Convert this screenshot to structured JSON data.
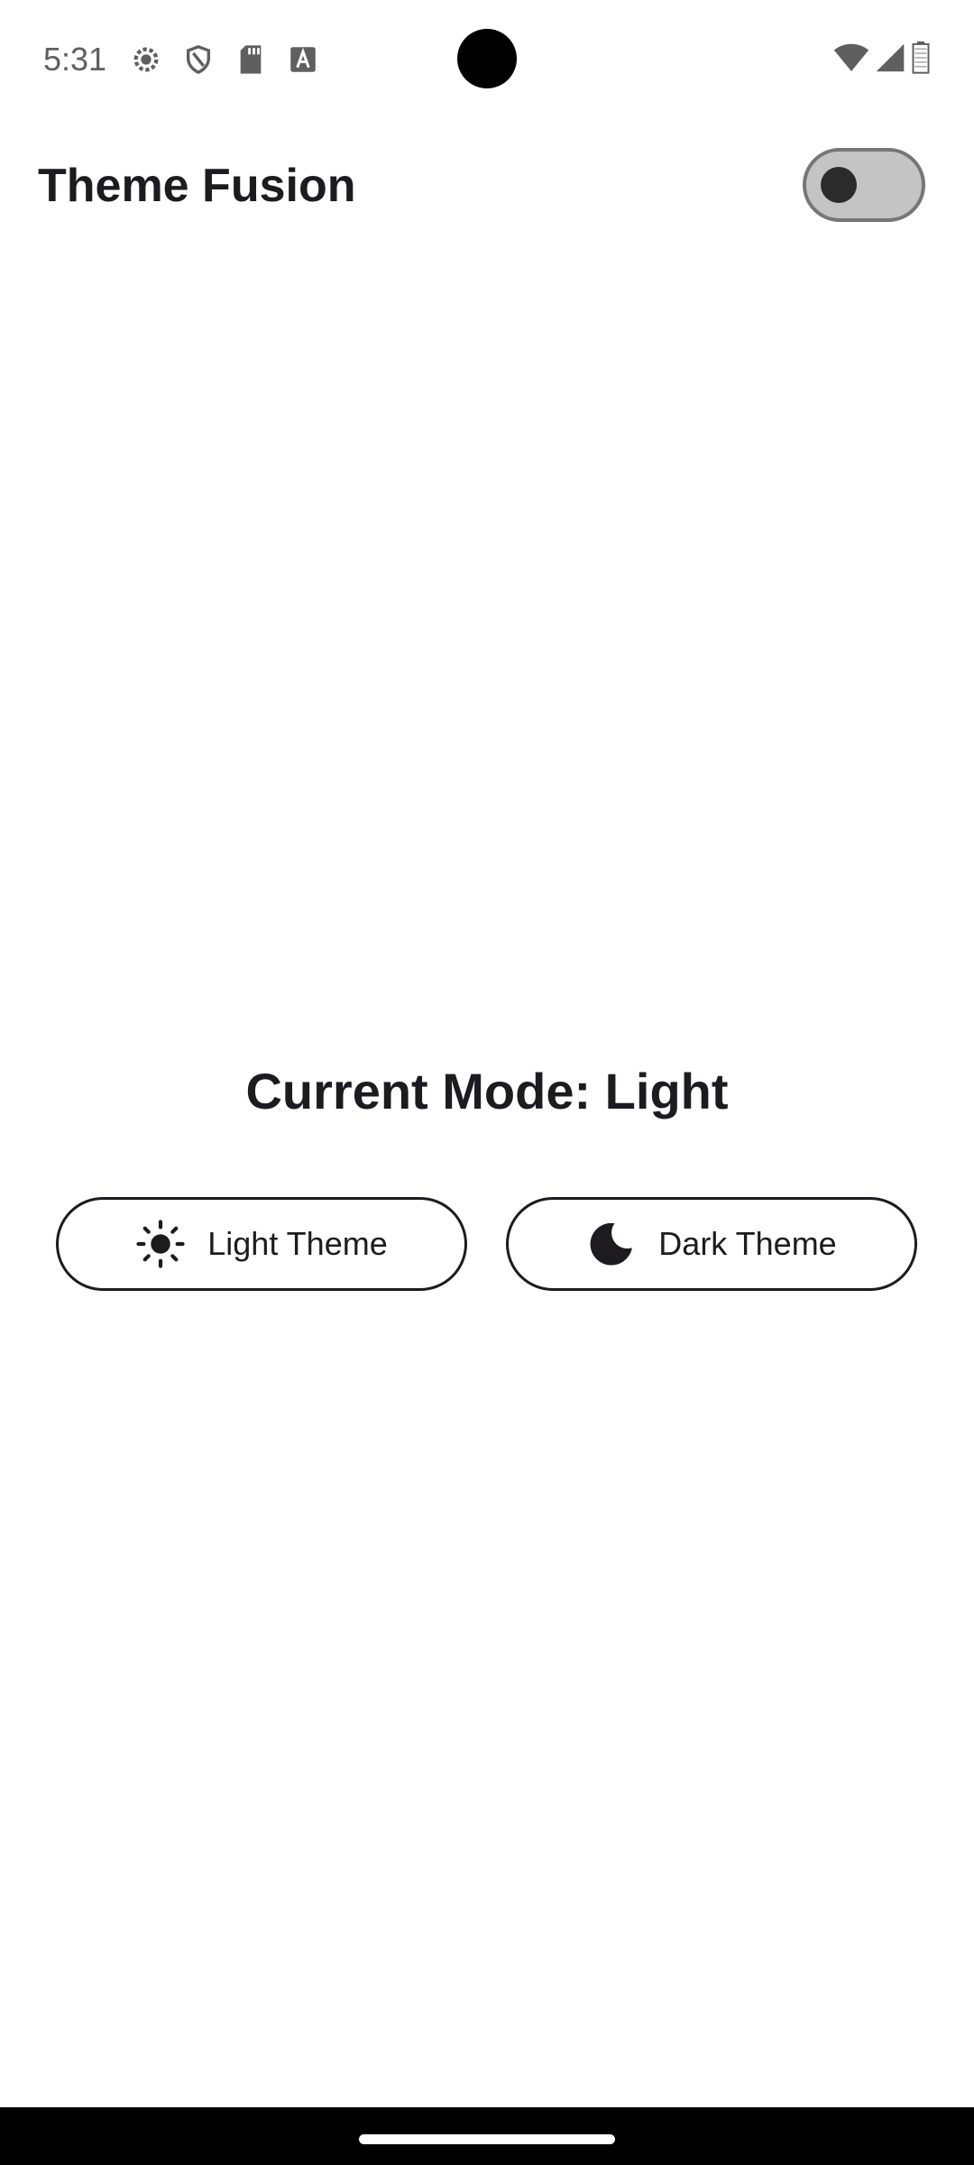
{
  "status_bar": {
    "time": "5:31",
    "left_icons": [
      "settings-sync-icon",
      "shield-icon",
      "sd-card-icon",
      "font-a-icon"
    ],
    "right_icons": [
      "wifi-icon",
      "signal-icon",
      "battery-icon"
    ]
  },
  "app_bar": {
    "title": "Theme Fusion",
    "dark_mode_switch": "off"
  },
  "main": {
    "mode_label": "Current Mode: Light",
    "buttons": [
      {
        "label": "Light Theme",
        "icon": "sun-icon"
      },
      {
        "label": "Dark Theme",
        "icon": "moon-icon"
      }
    ]
  },
  "colors": {
    "background": "#ffffff",
    "text": "#1d1b20",
    "switch_track": "#c4c4c4",
    "switch_border": "#747775",
    "switch_thumb": "#2b2b2b",
    "nav_bar": "#000000"
  }
}
